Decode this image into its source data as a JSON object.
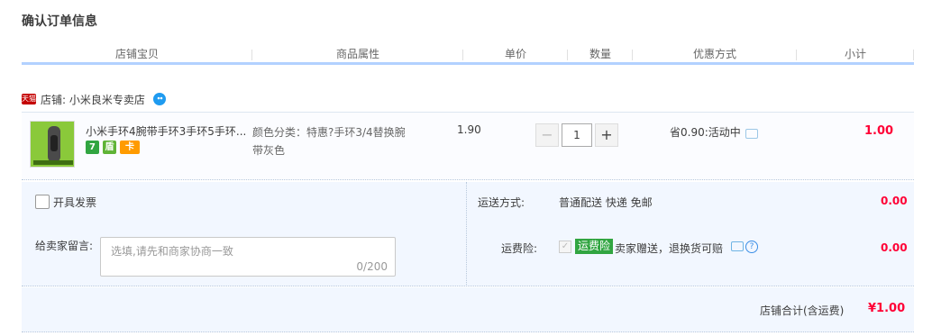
{
  "page": {
    "title": "确认订单信息"
  },
  "columns": [
    "店铺宝贝",
    "商品属性",
    "单价",
    "数量",
    "优惠方式",
    "小计"
  ],
  "shop": {
    "badge": "天猫",
    "label": "店铺: 小米良米专卖店"
  },
  "item": {
    "title": "小米手环4腕带手环3手环5手环...",
    "service_icons": [
      "7",
      "盾",
      "卡"
    ],
    "attribute": "颜色分类：特惠?手环3/4替换腕带灰色",
    "price": "1.90",
    "quantity_minus": "−",
    "quantity": "1",
    "quantity_plus": "+",
    "promo": "省0.90:活动中",
    "subtotal": "1.00"
  },
  "invoice": {
    "label": "开具发票"
  },
  "message": {
    "label": "给卖家留言:",
    "placeholder": "选填,请先和商家协商一致",
    "count": "0/200"
  },
  "shipping": {
    "label": "运送方式:",
    "value": "普通配送 快递 免邮",
    "fee": "0.00"
  },
  "insurance": {
    "label": "运费险:",
    "check": "✓",
    "tag": "运费险",
    "desc": "卖家赠送，退换货可赔",
    "help": "?",
    "fee": "0.00"
  },
  "total": {
    "label": "店铺合计(含运费)",
    "value": "¥1.00"
  },
  "colors": {
    "accent": "#ff0036",
    "header_line": "#b2d1ff",
    "panel_bg": "#f2f7ff",
    "green": "#31a541"
  }
}
